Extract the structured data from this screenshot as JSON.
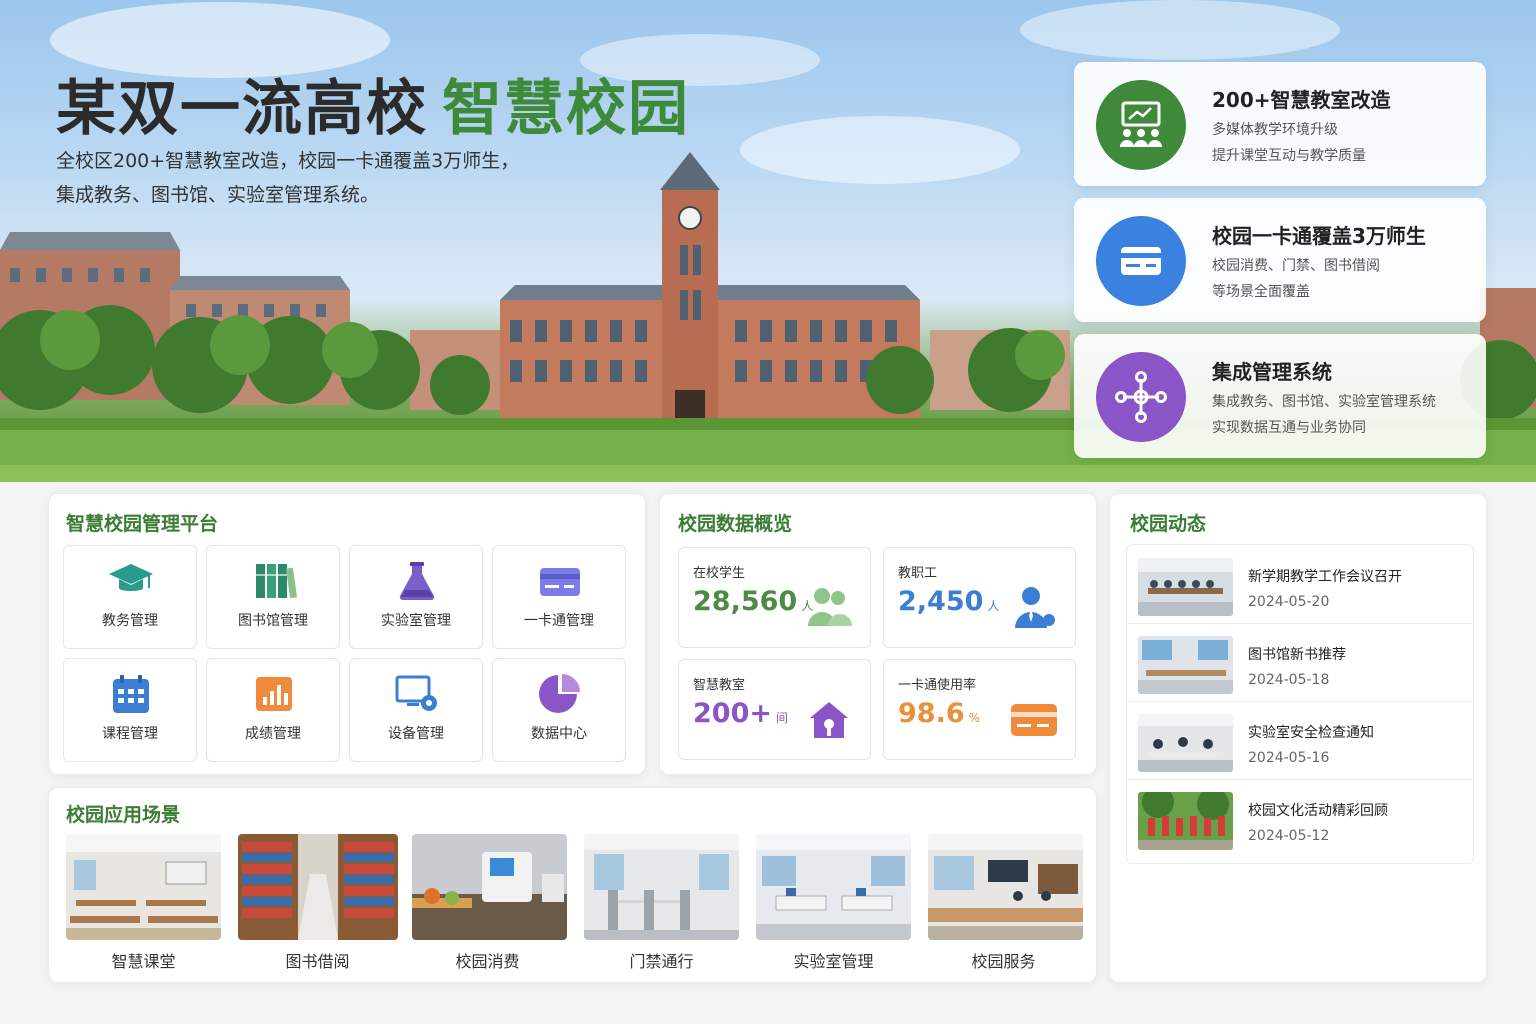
{
  "hero": {
    "title_main": "某双一流高校",
    "title_highlight": "智慧校园",
    "subtitle_line1": "全校区200+智慧教室改造，校园一卡通覆盖3万师生，",
    "subtitle_line2": "集成教务、图书馆、实验室管理系统。"
  },
  "feature_cards": [
    {
      "title": "200+智慧教室改造",
      "line1": "多媒体教学环境升级",
      "line2": "提升课堂互动与教学质量",
      "icon": "classroom-icon",
      "color": "#3f8a3a"
    },
    {
      "title": "校园一卡通覆盖3万师生",
      "line1": "校园消费、门禁、图书借阅",
      "line2": "等场景全面覆盖",
      "icon": "card-icon",
      "color": "#3b82e0"
    },
    {
      "title": "集成管理系统",
      "line1": "集成教务、图书馆、实验室管理系统",
      "line2": "实现数据互通与业务协同",
      "icon": "network-icon",
      "color": "#8a55c6"
    }
  ],
  "platform": {
    "title": "智慧校园管理平台",
    "modules": [
      {
        "label": "教务管理",
        "icon": "graduation-cap-icon"
      },
      {
        "label": "图书馆管理",
        "icon": "books-icon"
      },
      {
        "label": "实验室管理",
        "icon": "flask-icon"
      },
      {
        "label": "一卡通管理",
        "icon": "card-icon"
      },
      {
        "label": "课程管理",
        "icon": "calendar-icon"
      },
      {
        "label": "成绩管理",
        "icon": "bar-chart-icon"
      },
      {
        "label": "设备管理",
        "icon": "monitor-gear-icon"
      },
      {
        "label": "数据中心",
        "icon": "pie-chart-icon"
      }
    ]
  },
  "overview": {
    "title": "校园数据概览",
    "stats": [
      {
        "label": "在校学生",
        "value": "28,560",
        "unit": "人",
        "color": "#4d8a46",
        "icon": "students-icon"
      },
      {
        "label": "教职工",
        "value": "2,450",
        "unit": "人",
        "color": "#3b7fd4",
        "icon": "staff-icon"
      },
      {
        "label": "智慧教室",
        "value": "200+",
        "unit": "间",
        "color": "#8a55c6",
        "icon": "smart-classroom-icon"
      },
      {
        "label": "一卡通使用率",
        "value": "98.6",
        "unit": "%",
        "color": "#e8903a",
        "icon": "card-icon"
      }
    ]
  },
  "news": {
    "title": "校园动态",
    "items": [
      {
        "title": "新学期教学工作会议召开",
        "date": "2024-05-20"
      },
      {
        "title": "图书馆新书推荐",
        "date": "2024-05-18"
      },
      {
        "title": "实验室安全检查通知",
        "date": "2024-05-16"
      },
      {
        "title": "校园文化活动精彩回顾",
        "date": "2024-05-12"
      }
    ]
  },
  "scenes": {
    "title": "校园应用场景",
    "items": [
      {
        "label": "智慧课堂"
      },
      {
        "label": "图书借阅"
      },
      {
        "label": "校园消费"
      },
      {
        "label": "门禁通行"
      },
      {
        "label": "实验室管理"
      },
      {
        "label": "校园服务"
      }
    ]
  }
}
